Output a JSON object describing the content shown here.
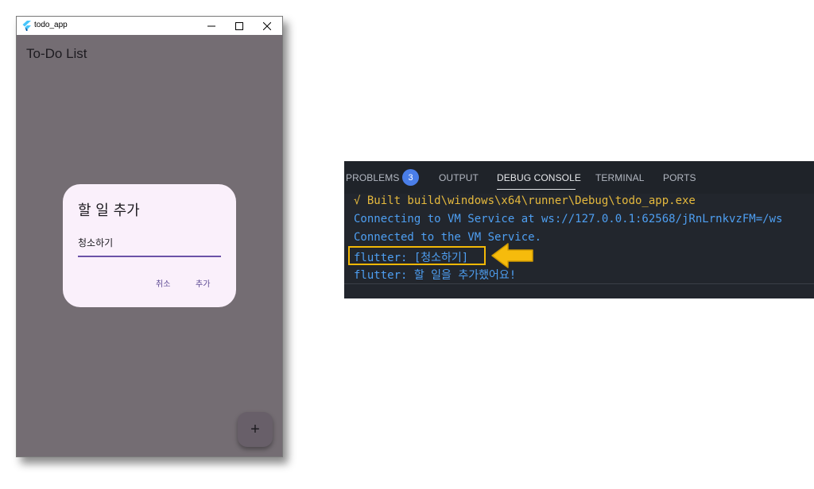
{
  "window": {
    "title": "todo_app",
    "controls": {
      "minimize": "—",
      "maximize": "☐",
      "close": "✕"
    }
  },
  "app": {
    "heading": "To-Do List",
    "background_color": "#746d73",
    "dialog": {
      "title": "할 일 추가",
      "input_value": "청소하기",
      "cancel_label": "취소",
      "add_label": "추가",
      "accent_color": "#6b52a8"
    },
    "fab_label": "+"
  },
  "vscode": {
    "tabs": [
      {
        "label": "PROBLEMS"
      },
      {
        "label": "OUTPUT"
      },
      {
        "label": "DEBUG CONSOLE"
      },
      {
        "label": "TERMINAL"
      },
      {
        "label": "PORTS"
      }
    ],
    "active_tab": "DEBUG CONSOLE",
    "problems_badge": "3",
    "console_lines": [
      "√ Built build\\windows\\x64\\runner\\Debug\\todo_app.exe",
      "Connecting to VM Service at ws://127.0.0.1:62568/jRnLrnkvzFM=/ws",
      "Connected to the VM Service.",
      "flutter: [청소하기]",
      "flutter: 할 일을 추가했어요!"
    ],
    "highlight_color": "#f3b806"
  }
}
